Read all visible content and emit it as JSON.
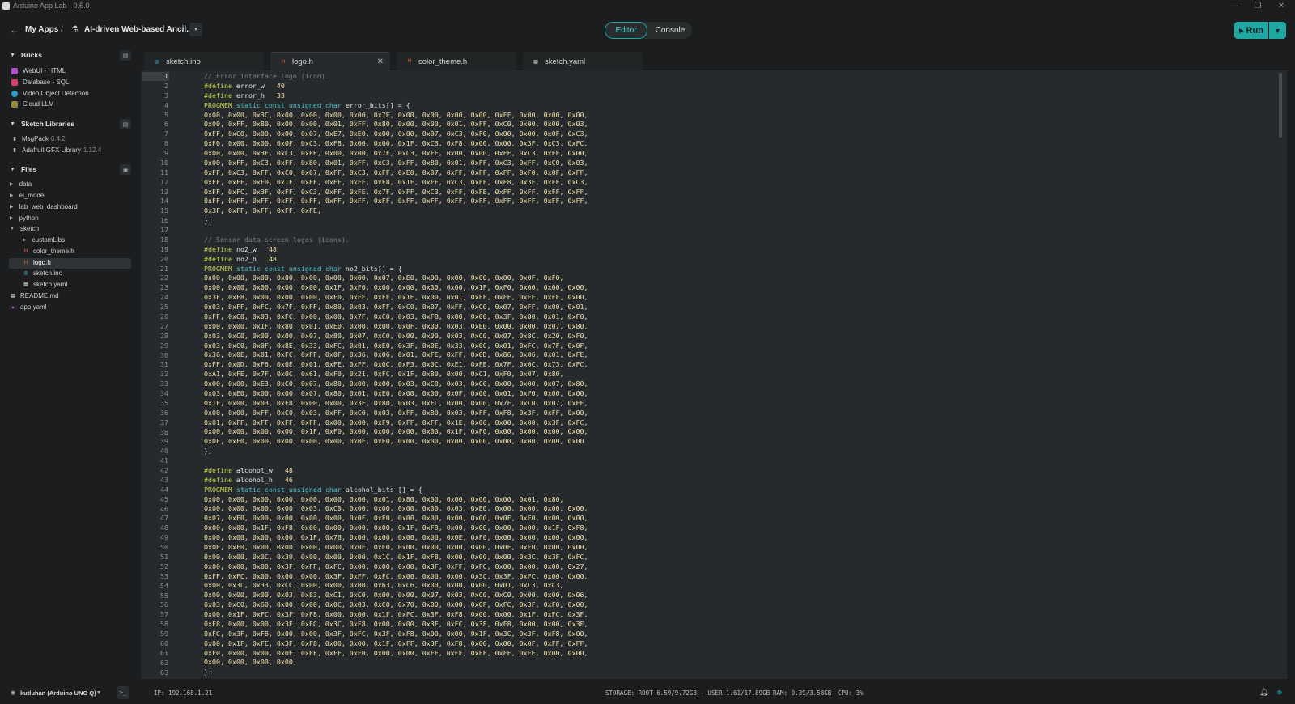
{
  "window": {
    "title": "Arduino App Lab - 0.6.0",
    "controls": [
      "—",
      "❐",
      "✕"
    ]
  },
  "header": {
    "back_label": "My Apps",
    "separator": "/",
    "app_name": "AI-driven Web-based Ancil...",
    "mode": {
      "editor": "Editor",
      "console": "Console",
      "active": "Editor"
    },
    "run_label": "Run"
  },
  "sidebar": {
    "bricks": {
      "title": "Bricks",
      "items": [
        {
          "label": "WebUI - HTML",
          "color": "#b34fd1"
        },
        {
          "label": "Database - SQL",
          "color": "#d9406b"
        },
        {
          "label": "Video Object Detection",
          "color": "#2aa0c0"
        },
        {
          "label": "Cloud LLM",
          "color": "#9a8a3a"
        }
      ]
    },
    "libraries": {
      "title": "Sketch Libraries",
      "items": [
        {
          "label": "MsgPack",
          "version": "0.4.2"
        },
        {
          "label": "Adafruit GFX Library",
          "version": "1.12.4"
        }
      ]
    },
    "files": {
      "title": "Files",
      "items": [
        {
          "label": "data",
          "kind": "folder",
          "depth": 0,
          "open": false
        },
        {
          "label": "ei_model",
          "kind": "folder",
          "depth": 0,
          "open": false
        },
        {
          "label": "lab_web_dashboard",
          "kind": "folder",
          "depth": 0,
          "open": false
        },
        {
          "label": "python",
          "kind": "folder",
          "depth": 0,
          "open": false
        },
        {
          "label": "sketch",
          "kind": "folder",
          "depth": 0,
          "open": true
        },
        {
          "label": "customLibs",
          "kind": "folder",
          "depth": 1,
          "open": false
        },
        {
          "label": "color_theme.h",
          "kind": "h",
          "depth": 1
        },
        {
          "label": "logo.h",
          "kind": "h",
          "depth": 1,
          "selected": true
        },
        {
          "label": "sketch.ino",
          "kind": "ino",
          "depth": 1
        },
        {
          "label": "sketch.yaml",
          "kind": "yaml",
          "depth": 1
        },
        {
          "label": "README.md",
          "kind": "md",
          "depth": 0
        },
        {
          "label": "app.yaml",
          "kind": "app",
          "depth": 0
        }
      ]
    }
  },
  "tabs": [
    {
      "label": "sketch.ino",
      "kind": "ino",
      "active": false
    },
    {
      "label": "logo.h",
      "kind": "h",
      "active": true
    },
    {
      "label": "color_theme.h",
      "kind": "h",
      "active": false
    },
    {
      "label": "sketch.yaml",
      "kind": "yaml",
      "active": false
    }
  ],
  "editor": {
    "current_line": 1,
    "lines": [
      "    // Error interface logo (icon).",
      "    #define error_w   40",
      "    #define error_h   33",
      "    PROGMEM static const unsigned char error_bits[] = {",
      "    0x00, 0x00, 0x3C, 0x00, 0x00, 0x00, 0x00, 0x7E, 0x00, 0x00, 0x00, 0x00, 0xFF, 0x00, 0x00, 0x00,",
      "    0x00, 0xFF, 0x80, 0x00, 0x00, 0x01, 0xFF, 0x80, 0x00, 0x00, 0x01, 0xFF, 0xC0, 0x00, 0x00, 0x03,",
      "    0xFF, 0xC0, 0x00, 0x00, 0x07, 0xE7, 0xE0, 0x00, 0x00, 0x07, 0xC3, 0xF0, 0x00, 0x00, 0x0F, 0xC3,",
      "    0xF0, 0x00, 0x00, 0x0F, 0xC3, 0xF8, 0x00, 0x00, 0x1F, 0xC3, 0xF8, 0x00, 0x00, 0x3F, 0xC3, 0xFC,",
      "    0x00, 0x00, 0x3F, 0xC3, 0xFE, 0x00, 0x00, 0x7F, 0xC3, 0xFE, 0x00, 0x00, 0xFF, 0xC3, 0xFF, 0x00,",
      "    0x00, 0xFF, 0xC3, 0xFF, 0x80, 0x01, 0xFF, 0xC3, 0xFF, 0x80, 0x01, 0xFF, 0xC3, 0xFF, 0xC0, 0x03,",
      "    0xFF, 0xC3, 0xFF, 0xC0, 0x07, 0xFF, 0xC3, 0xFF, 0xE0, 0x07, 0xFF, 0xFF, 0xFF, 0xF0, 0x0F, 0xFF,",
      "    0xFF, 0xFF, 0xF0, 0x1F, 0xFF, 0xFF, 0xFF, 0xF8, 0x1F, 0xFF, 0xC3, 0xFF, 0xF8, 0x3F, 0xFF, 0xC3,",
      "    0xFF, 0xFC, 0x3F, 0xFF, 0xC3, 0xFF, 0xFE, 0x7F, 0xFF, 0xC3, 0xFF, 0xFE, 0xFF, 0xFF, 0xFF, 0xFF,",
      "    0xFF, 0xFF, 0xFF, 0xFF, 0xFF, 0xFF, 0xFF, 0xFF, 0xFF, 0xFF, 0xFF, 0xFF, 0xFF, 0xFF, 0xFF, 0xFF,",
      "    0x3F, 0xFF, 0xFF, 0xFF, 0xFE,",
      "    };",
      "",
      "    // Sensor data screen logos (icons).",
      "    #define no2_w   48",
      "    #define no2_h   48",
      "    PROGMEM static const unsigned char no2_bits[] = {",
      "    0x00, 0x00, 0x00, 0x00, 0x00, 0x00, 0x00, 0x07, 0xE0, 0x00, 0x00, 0x00, 0x00, 0x0F, 0xF0,",
      "    0x00, 0x00, 0x00, 0x00, 0x00, 0x1F, 0xF0, 0x00, 0x00, 0x00, 0x00, 0x1F, 0xF0, 0x00, 0x00, 0x00,",
      "    0x3F, 0xF8, 0x00, 0x00, 0x00, 0xF0, 0xFF, 0xFF, 0x1E, 0x00, 0x01, 0xFF, 0xFF, 0xFF, 0xFF, 0x00,",
      "    0x03, 0xFF, 0xFC, 0x7F, 0xFF, 0x80, 0x03, 0xFF, 0xC0, 0x07, 0xFF, 0xC0, 0x07, 0xFF, 0x00, 0x01,",
      "    0xFF, 0xC0, 0x03, 0xFC, 0x00, 0x00, 0x7F, 0xC0, 0x03, 0xF8, 0x00, 0x00, 0x3F, 0x80, 0x01, 0xF0,",
      "    0x00, 0x00, 0x1F, 0x80, 0x01, 0xE0, 0x00, 0x00, 0x0F, 0x00, 0x03, 0xE0, 0x00, 0x00, 0x07, 0x80,",
      "    0x03, 0xC0, 0x00, 0x00, 0x07, 0x80, 0x07, 0xC0, 0x00, 0x00, 0x03, 0xC0, 0x07, 0x8C, 0x20, 0xF0,",
      "    0x03, 0xC0, 0x0F, 0x8E, 0x33, 0xFC, 0x01, 0xE0, 0x3F, 0x0E, 0x33, 0x0C, 0x01, 0xFC, 0x7F, 0x0F,",
      "    0x36, 0x0E, 0x01, 0xFC, 0xFF, 0x0F, 0x36, 0x06, 0x01, 0xFE, 0xFF, 0x0D, 0x86, 0x06, 0x01, 0xFE,",
      "    0xFF, 0x0D, 0xF6, 0x0E, 0x01, 0xFE, 0xFF, 0x0C, 0xF3, 0x0C, 0xE1, 0xFE, 0x7F, 0x0C, 0x73, 0xFC,",
      "    0xA1, 0xFE, 0x7F, 0x0C, 0x61, 0xF0, 0x21, 0xFC, 0x1F, 0x80, 0x00, 0xC1, 0xF0, 0x07, 0x80,",
      "    0x00, 0x00, 0xE3, 0xC0, 0x07, 0x80, 0x00, 0x00, 0x03, 0xC0, 0x03, 0xC0, 0x00, 0x00, 0x07, 0x80,",
      "    0x03, 0xE0, 0x00, 0x00, 0x07, 0x80, 0x01, 0xE0, 0x00, 0x00, 0x0F, 0x00, 0x01, 0xF0, 0x00, 0x00,",
      "    0x1F, 0x00, 0x03, 0xF8, 0x00, 0x00, 0x3F, 0x80, 0x03, 0xFC, 0x00, 0x00, 0x7F, 0xC0, 0x07, 0xFF,",
      "    0x00, 0x00, 0xFF, 0xC0, 0x03, 0xFF, 0xC0, 0x03, 0xFF, 0x80, 0x03, 0xFF, 0xF8, 0x3F, 0xFF, 0x00,",
      "    0x01, 0xFF, 0xFF, 0xFF, 0xFF, 0x00, 0x00, 0xF9, 0xFF, 0xFF, 0x1E, 0x00, 0x00, 0x00, 0x3F, 0xFC,",
      "    0x00, 0x00, 0x00, 0x00, 0x1F, 0xF0, 0x00, 0x00, 0x00, 0x00, 0x1F, 0xF0, 0x00, 0x00, 0x00, 0x00,",
      "    0x0F, 0xF0, 0x00, 0x00, 0x00, 0x00, 0x0F, 0xE0, 0x00, 0x00, 0x00, 0x00, 0x00, 0x00, 0x00, 0x00",
      "    };",
      "",
      "    #define alcohol_w   48",
      "    #define alcohol_h   46",
      "    PROGMEM static const unsigned char alcohol_bits [] = {",
      "    0x00, 0x00, 0x00, 0x00, 0x00, 0x00, 0x00, 0x01, 0x80, 0x00, 0x00, 0x00, 0x00, 0x01, 0x80,",
      "    0x00, 0x00, 0x00, 0x00, 0x03, 0xC0, 0x00, 0x00, 0x00, 0x00, 0x03, 0xE0, 0x00, 0x00, 0x00, 0x00,",
      "    0x07, 0xF0, 0x00, 0x00, 0x00, 0x00, 0x0F, 0xF0, 0x00, 0x00, 0x00, 0x00, 0x0F, 0xF0, 0x00, 0x00,",
      "    0x00, 0x00, 0x1F, 0xF8, 0x00, 0x00, 0x00, 0x00, 0x1F, 0xF8, 0x00, 0x00, 0x00, 0x00, 0x1F, 0xF8,",
      "    0x00, 0x00, 0x00, 0x00, 0x1F, 0x78, 0x00, 0x00, 0x00, 0x00, 0x0E, 0xF0, 0x00, 0x00, 0x00, 0x00,",
      "    0x0E, 0xF0, 0x00, 0x00, 0x00, 0x00, 0x0F, 0xE0, 0x00, 0x00, 0x00, 0x00, 0x0F, 0xF0, 0x00, 0x00,",
      "    0x00, 0x00, 0x0C, 0x30, 0x00, 0x00, 0x00, 0x1C, 0x1F, 0xF8, 0x00, 0x00, 0x00, 0x3C, 0x3F, 0xFC,",
      "    0x00, 0x00, 0x00, 0x3F, 0xFF, 0xFC, 0x00, 0x00, 0x00, 0x3F, 0xFF, 0xFC, 0x00, 0x00, 0x00, 0x27,",
      "    0xFF, 0xFC, 0x00, 0x00, 0x00, 0x3F, 0xFF, 0xFC, 0x00, 0x00, 0x00, 0x3C, 0x3F, 0xFC, 0x00, 0x00,",
      "    0x00, 0x3C, 0x33, 0xCC, 0x00, 0x00, 0x00, 0x63, 0xC6, 0x00, 0x00, 0x00, 0x01, 0xC3, 0xC3,",
      "    0x00, 0x00, 0x00, 0x03, 0x83, 0xC1, 0xC0, 0x00, 0x00, 0x07, 0x03, 0xC0, 0xC0, 0x00, 0x00, 0x06,",
      "    0x03, 0xC0, 0x60, 0x00, 0x00, 0x0C, 0x03, 0xC0, 0x70, 0x00, 0x00, 0x0F, 0xFC, 0x3F, 0xF0, 0x00,",
      "    0x00, 0x1F, 0xFC, 0x3F, 0xF8, 0x00, 0x00, 0x1F, 0xFC, 0x3F, 0xF8, 0x00, 0x00, 0x1F, 0xFC, 0x3F,",
      "    0xF8, 0x00, 0x00, 0x3F, 0xFC, 0x3C, 0xF8, 0x00, 0x00, 0x3F, 0xFC, 0x3F, 0xF8, 0x00, 0x00, 0x3F,",
      "    0xFC, 0x3F, 0xF8, 0x00, 0x00, 0x3F, 0xFC, 0x3F, 0xF8, 0x00, 0x00, 0x1F, 0x3C, 0x3F, 0xF8, 0x00,",
      "    0x00, 0x1F, 0xFE, 0x3F, 0xF8, 0x00, 0x00, 0x1F, 0xFF, 0x3F, 0xF8, 0x00, 0x00, 0x0F, 0xFF, 0xFF,",
      "    0xF0, 0x00, 0x00, 0x0F, 0xFF, 0xFF, 0xF0, 0x00, 0x00, 0xFF, 0xFF, 0xFF, 0xFF, 0xFE, 0x00, 0x00,",
      "    0x00, 0x00, 0x00, 0x00,",
      "    };"
    ]
  },
  "status": {
    "board": "kutluhan (Arduino UNO Q)",
    "ip": "IP: 192.168.1.21",
    "storage": "STORAGE: ROOT 6.59/9.72GB - USER 1.61/17.89GB",
    "ram": "RAM: 0.39/3.58GB",
    "cpu": "CPU: 3%"
  },
  "colors": {
    "accent": "#1fa7a2",
    "h_icon": "#c0503a",
    "ino_icon": "#3aa0b8",
    "yaml_icon": "#9a9a9a"
  }
}
